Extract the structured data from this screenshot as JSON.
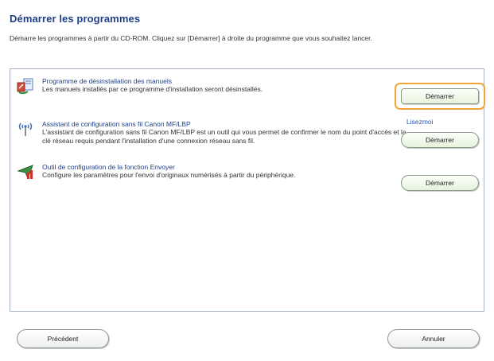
{
  "title": "Démarrer les programmes",
  "intro": "Démarre les programmes à partir du CD-ROM. Cliquez sur [Démarrer] à droite du programme que vous souhaitez lancer.",
  "programs": [
    {
      "name": "Programme de désinstallation des manuels",
      "description": "Les manuels installés par ce programme d'installation seront désinstallés.",
      "icon": "uninstall-manuals-icon",
      "button": "Démarrer"
    },
    {
      "name": "Assistant de configuration sans fil Canon MF/LBP",
      "description": "L'assistant de configuration sans fil Canon MF/LBP est un outil qui vous permet de confirmer le nom du point d'accès et la clé réseau requis pendant l'installation d'une connexion réseau sans fil.",
      "icon": "wireless-antenna-icon",
      "link": "Lisezmoi",
      "button": "Démarrer"
    },
    {
      "name": "Outil de configuration de la fonction Envoyer",
      "description": "Configure les paramètres pour l'envoi d'originaux numérisés à partir du périphérique.",
      "icon": "send-function-icon",
      "button": "Démarrer"
    }
  ],
  "footer": {
    "back": "Précédent",
    "cancel": "Annuler"
  },
  "colors": {
    "title": "#1f3f87",
    "focus": "#f2a33a",
    "link": "#2c57b8"
  }
}
